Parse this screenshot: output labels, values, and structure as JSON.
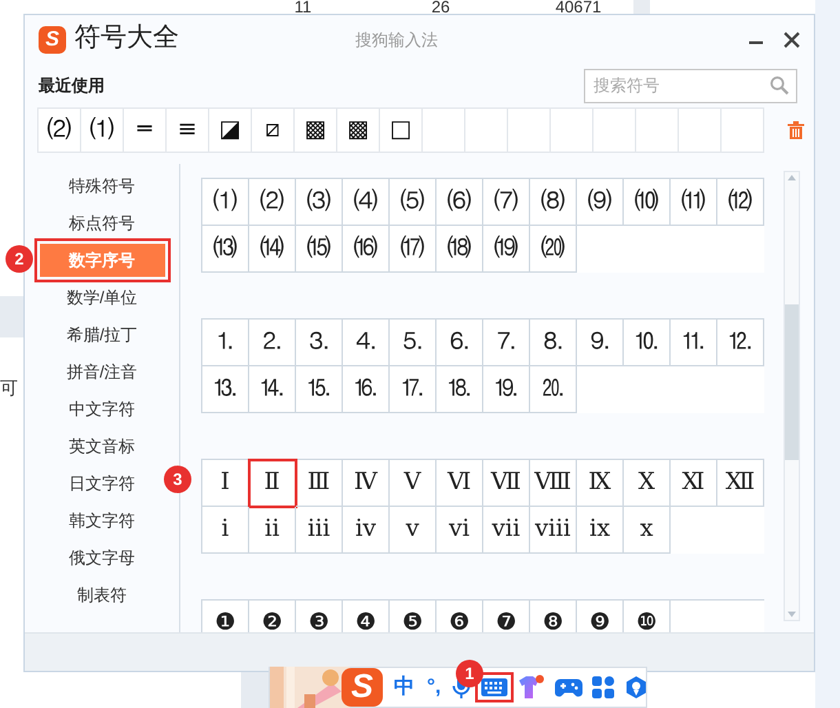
{
  "background": {
    "table_cells": [
      "11",
      "26",
      "40671"
    ],
    "side_text": "可"
  },
  "window": {
    "logo_text": "S",
    "title": "符号大全",
    "subtitle": "搜狗输入法"
  },
  "recent": {
    "label": "最近使用",
    "search": {
      "placeholder": "搜索符号"
    },
    "symbols": [
      "⑵",
      "⑴",
      "═",
      "≡",
      "◪",
      "⧄",
      "▩",
      "▩",
      "□"
    ]
  },
  "sidebar": {
    "items": [
      {
        "label": "特殊符号",
        "selected": false,
        "highlighted": false
      },
      {
        "label": "标点符号",
        "selected": false,
        "highlighted": false
      },
      {
        "label": "数字序号",
        "selected": true,
        "highlighted": true,
        "callout": "2"
      },
      {
        "label": "数学/单位",
        "selected": false,
        "highlighted": false
      },
      {
        "label": "希腊/拉丁",
        "selected": false,
        "highlighted": false
      },
      {
        "label": "拼音/注音",
        "selected": false,
        "highlighted": false
      },
      {
        "label": "中文字符",
        "selected": false,
        "highlighted": false
      },
      {
        "label": "英文音标",
        "selected": false,
        "highlighted": false
      },
      {
        "label": "日文字符",
        "selected": false,
        "highlighted": false
      },
      {
        "label": "韩文字符",
        "selected": false,
        "highlighted": false
      },
      {
        "label": "俄文字母",
        "selected": false,
        "highlighted": false
      },
      {
        "label": "制表符",
        "selected": false,
        "highlighted": false
      }
    ]
  },
  "sections": [
    {
      "cells": [
        {
          "symbol": "⑴",
          "highlighted": false
        },
        {
          "symbol": "⑵",
          "highlighted": false
        },
        {
          "symbol": "⑶",
          "highlighted": false
        },
        {
          "symbol": "⑷",
          "highlighted": false
        },
        {
          "symbol": "⑸",
          "highlighted": false
        },
        {
          "symbol": "⑹",
          "highlighted": false
        },
        {
          "symbol": "⑺",
          "highlighted": false
        },
        {
          "symbol": "⑻",
          "highlighted": false
        },
        {
          "symbol": "⑼",
          "highlighted": false
        },
        {
          "symbol": "⑽",
          "highlighted": false
        },
        {
          "symbol": "⑾",
          "highlighted": false
        },
        {
          "symbol": "⑿",
          "highlighted": false
        },
        {
          "symbol": "⒀",
          "highlighted": false
        },
        {
          "symbol": "⒁",
          "highlighted": false
        },
        {
          "symbol": "⒂",
          "highlighted": false
        },
        {
          "symbol": "⒃",
          "highlighted": false
        },
        {
          "symbol": "⒄",
          "highlighted": false
        },
        {
          "symbol": "⒅",
          "highlighted": false
        },
        {
          "symbol": "⒆",
          "highlighted": false
        },
        {
          "symbol": "⒇",
          "highlighted": false
        }
      ]
    },
    {
      "cells": [
        {
          "symbol": "⒈",
          "highlighted": false
        },
        {
          "symbol": "⒉",
          "highlighted": false
        },
        {
          "symbol": "⒊",
          "highlighted": false
        },
        {
          "symbol": "⒋",
          "highlighted": false
        },
        {
          "symbol": "⒌",
          "highlighted": false
        },
        {
          "symbol": "⒍",
          "highlighted": false
        },
        {
          "symbol": "⒎",
          "highlighted": false
        },
        {
          "symbol": "⒏",
          "highlighted": false
        },
        {
          "symbol": "⒐",
          "highlighted": false
        },
        {
          "symbol": "⒑",
          "highlighted": false
        },
        {
          "symbol": "⒒",
          "highlighted": false
        },
        {
          "symbol": "⒓",
          "highlighted": false
        },
        {
          "symbol": "⒔",
          "highlighted": false
        },
        {
          "symbol": "⒕",
          "highlighted": false
        },
        {
          "symbol": "⒖",
          "highlighted": false
        },
        {
          "symbol": "⒗",
          "highlighted": false
        },
        {
          "symbol": "⒘",
          "highlighted": false
        },
        {
          "symbol": "⒙",
          "highlighted": false
        },
        {
          "symbol": "⒚",
          "highlighted": false
        },
        {
          "symbol": "⒛",
          "highlighted": false
        }
      ]
    },
    {
      "cells": [
        {
          "symbol": "Ⅰ",
          "highlighted": false
        },
        {
          "symbol": "Ⅱ",
          "highlighted": true,
          "callout": "3"
        },
        {
          "symbol": "Ⅲ",
          "highlighted": false
        },
        {
          "symbol": "Ⅳ",
          "highlighted": false
        },
        {
          "symbol": "Ⅴ",
          "highlighted": false
        },
        {
          "symbol": "Ⅵ",
          "highlighted": false
        },
        {
          "symbol": "Ⅶ",
          "highlighted": false
        },
        {
          "symbol": "Ⅷ",
          "highlighted": false
        },
        {
          "symbol": "Ⅸ",
          "highlighted": false
        },
        {
          "symbol": "Ⅹ",
          "highlighted": false
        },
        {
          "symbol": "Ⅺ",
          "highlighted": false
        },
        {
          "symbol": "Ⅻ",
          "highlighted": false
        },
        {
          "symbol": "ⅰ",
          "highlighted": false
        },
        {
          "symbol": "ⅱ",
          "highlighted": false
        },
        {
          "symbol": "ⅲ",
          "highlighted": false
        },
        {
          "symbol": "ⅳ",
          "highlighted": false
        },
        {
          "symbol": "ⅴ",
          "highlighted": false
        },
        {
          "symbol": "ⅵ",
          "highlighted": false
        },
        {
          "symbol": "ⅶ",
          "highlighted": false
        },
        {
          "symbol": "ⅷ",
          "highlighted": false
        },
        {
          "symbol": "ⅸ",
          "highlighted": false
        },
        {
          "symbol": "ⅹ",
          "highlighted": false
        }
      ]
    },
    {
      "cells": [
        {
          "symbol": "❶",
          "highlighted": false
        },
        {
          "symbol": "❷",
          "highlighted": false
        },
        {
          "symbol": "❸",
          "highlighted": false
        },
        {
          "symbol": "❹",
          "highlighted": false
        },
        {
          "symbol": "❺",
          "highlighted": false
        },
        {
          "symbol": "❻",
          "highlighted": false
        },
        {
          "symbol": "❼",
          "highlighted": false
        },
        {
          "symbol": "❽",
          "highlighted": false
        },
        {
          "symbol": "❾",
          "highlighted": false
        },
        {
          "symbol": "❿",
          "highlighted": false
        }
      ]
    }
  ],
  "taskbar": {
    "items": [
      {
        "kind": "logo",
        "text": "S"
      },
      {
        "kind": "text",
        "text": "中"
      },
      {
        "kind": "text",
        "text": "°,"
      },
      {
        "kind": "mic"
      },
      {
        "kind": "keyboard",
        "highlighted": true,
        "callout": "1"
      },
      {
        "kind": "shirt"
      },
      {
        "kind": "gamepad"
      },
      {
        "kind": "apps"
      },
      {
        "kind": "settings"
      }
    ]
  }
}
